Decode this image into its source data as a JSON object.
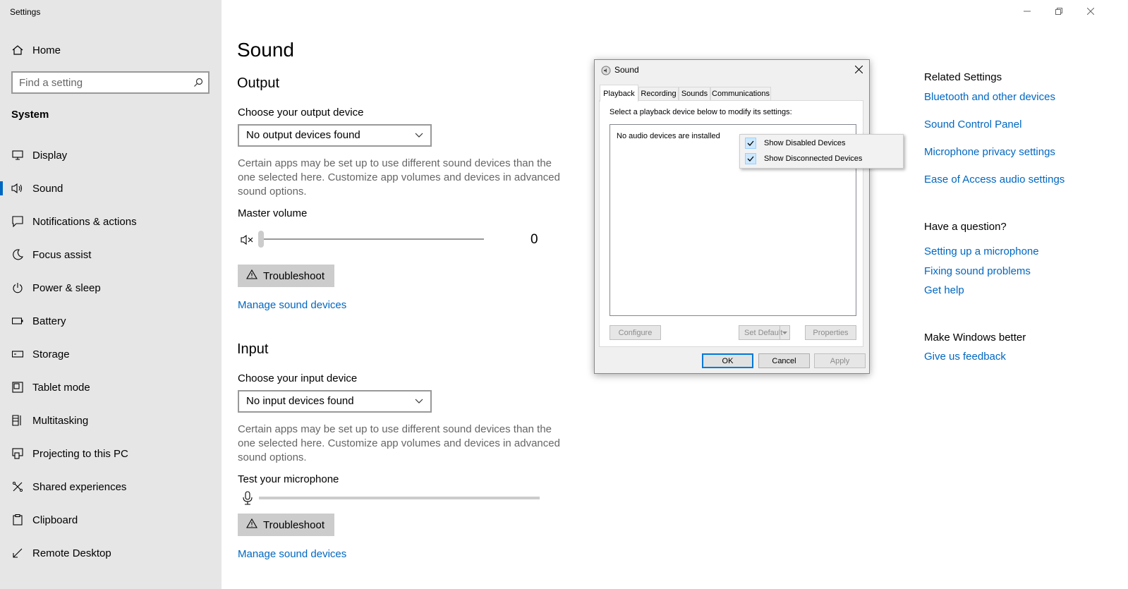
{
  "window": {
    "title": "Settings"
  },
  "sidebar": {
    "home": "Home",
    "search_placeholder": "Find a setting",
    "section": "System",
    "items": [
      {
        "label": "Display",
        "icon": "monitor-icon"
      },
      {
        "label": "Sound",
        "icon": "speaker-icon",
        "active": true
      },
      {
        "label": "Notifications & actions",
        "icon": "notification-icon"
      },
      {
        "label": "Focus assist",
        "icon": "moon-icon"
      },
      {
        "label": "Power & sleep",
        "icon": "power-icon"
      },
      {
        "label": "Battery",
        "icon": "battery-icon"
      },
      {
        "label": "Storage",
        "icon": "storage-icon"
      },
      {
        "label": "Tablet mode",
        "icon": "tablet-icon"
      },
      {
        "label": "Multitasking",
        "icon": "multitasking-icon"
      },
      {
        "label": "Projecting to this PC",
        "icon": "projector-icon"
      },
      {
        "label": "Shared experiences",
        "icon": "shared-icon"
      },
      {
        "label": "Clipboard",
        "icon": "clipboard-icon"
      },
      {
        "label": "Remote Desktop",
        "icon": "remote-icon"
      }
    ]
  },
  "main": {
    "title": "Sound",
    "output": {
      "heading": "Output",
      "choose_label": "Choose your output device",
      "device_value": "No output devices found",
      "description": "Certain apps may be set up to use different sound devices than the one selected here. Customize app volumes and devices in advanced sound options.",
      "volume_label": "Master volume",
      "volume_value": "0",
      "troubleshoot": "Troubleshoot",
      "manage_link": "Manage sound devices"
    },
    "input": {
      "heading": "Input",
      "choose_label": "Choose your input device",
      "device_value": "No input devices found",
      "description": "Certain apps may be set up to use different sound devices than the one selected here. Customize app volumes and devices in advanced sound options.",
      "test_label": "Test your microphone",
      "troubleshoot": "Troubleshoot",
      "manage_link": "Manage sound devices"
    }
  },
  "related": {
    "heading": "Related Settings",
    "links": [
      "Bluetooth and other devices",
      "Sound Control Panel",
      "Microphone privacy settings",
      "Ease of Access audio settings"
    ],
    "question_heading": "Have a question?",
    "question_links": [
      "Setting up a microphone",
      "Fixing sound problems",
      "Get help"
    ],
    "better_heading": "Make Windows better",
    "feedback_link": "Give us feedback"
  },
  "dialog": {
    "title": "Sound",
    "tabs": [
      "Playback",
      "Recording",
      "Sounds",
      "Communications"
    ],
    "instruction": "Select a playback device below to modify its settings:",
    "empty_message": "No audio devices are installed",
    "buttons": {
      "configure": "Configure",
      "set_default": "Set Default",
      "properties": "Properties",
      "ok": "OK",
      "cancel": "Cancel",
      "apply": "Apply"
    },
    "context_menu": [
      {
        "label": "Show Disabled Devices",
        "checked": true
      },
      {
        "label": "Show Disconnected Devices",
        "checked": true
      }
    ]
  },
  "colors": {
    "accent": "#0067c0",
    "sidebar_bg": "#e6e6e6"
  }
}
